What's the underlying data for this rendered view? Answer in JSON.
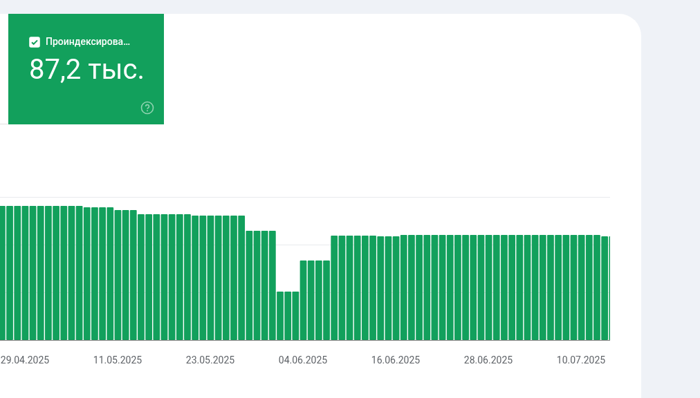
{
  "metric_tile": {
    "label": "Проиндексирова…",
    "checked": true,
    "value": "87,2 тыс."
  },
  "chart": {
    "x_labels": [
      "29.04.2025",
      "11.05.2025",
      "23.05.2025",
      "04.06.2025",
      "16.06.2025",
      "28.06.2025",
      "10.07.2025"
    ]
  }
}
